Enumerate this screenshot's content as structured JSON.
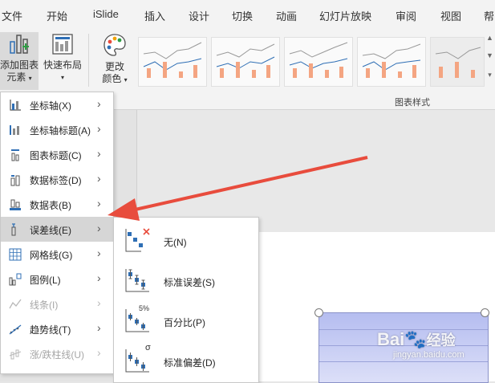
{
  "tabs": [
    "文件",
    "开始",
    "iSlide",
    "插入",
    "设计",
    "切换",
    "动画",
    "幻灯片放映",
    "审阅",
    "视图",
    "帮"
  ],
  "ribbon": {
    "add_chart_element_line1": "添加图表",
    "add_chart_element_line2": "元素",
    "quick_layout": "快速布局",
    "change_colors_line1": "更改",
    "change_colors_line2": "颜色",
    "chart_styles_group": "图表样式"
  },
  "menu": {
    "items": [
      {
        "label": "坐标轴(X)",
        "icon": "axes-icon",
        "enabled": true
      },
      {
        "label": "坐标轴标题(A)",
        "icon": "axis-titles-icon",
        "enabled": true
      },
      {
        "label": "图表标题(C)",
        "icon": "chart-title-icon",
        "enabled": true
      },
      {
        "label": "数据标签(D)",
        "icon": "data-labels-icon",
        "enabled": true
      },
      {
        "label": "数据表(B)",
        "icon": "data-table-icon",
        "enabled": true
      },
      {
        "label": "误差线(E)",
        "icon": "error-bars-icon",
        "enabled": true,
        "highlighted": true
      },
      {
        "label": "网格线(G)",
        "icon": "gridlines-icon",
        "enabled": true
      },
      {
        "label": "图例(L)",
        "icon": "legend-icon",
        "enabled": true
      },
      {
        "label": "线条(I)",
        "icon": "lines-icon",
        "enabled": false
      },
      {
        "label": "趋势线(T)",
        "icon": "trendline-icon",
        "enabled": true
      },
      {
        "label": "涨/跌柱线(U)",
        "icon": "up-down-bars-icon",
        "enabled": false
      }
    ]
  },
  "submenu": {
    "items": [
      {
        "label": "无(N)",
        "icon": "error-bars-none-icon"
      },
      {
        "label": "标准误差(S)",
        "icon": "standard-error-icon"
      },
      {
        "label": "百分比(P)",
        "icon": "percentage-icon",
        "badge": "5%"
      },
      {
        "label": "标准偏差(D)",
        "icon": "standard-deviation-icon",
        "badge": "σ"
      }
    ]
  },
  "watermark": {
    "brand": "Bai",
    "brand2": "经验",
    "url": "jingyan.baidu.com"
  },
  "colors": {
    "accent": "#e84c3d",
    "highlight": "#d6d6d6",
    "icon_blue": "#2f6fb5"
  }
}
